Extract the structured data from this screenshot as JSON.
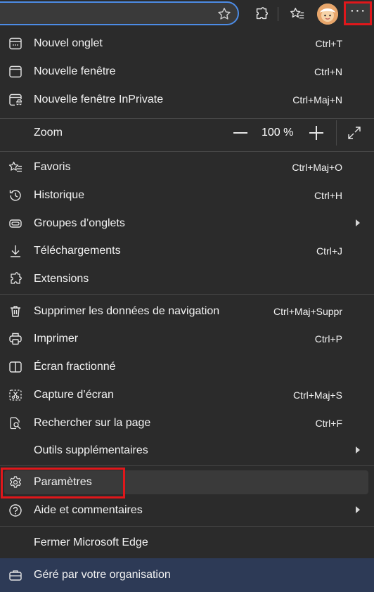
{
  "toolbar": {
    "favorite_star_icon": "star-outline-icon",
    "extensions_icon": "puzzle-icon",
    "favorites_icon": "favorites-icon",
    "profile_icon": "avatar",
    "more_label": "···"
  },
  "menu": {
    "new_tab": {
      "label": "Nouvel onglet",
      "shortcut": "Ctrl+T"
    },
    "new_window": {
      "label": "Nouvelle fenêtre",
      "shortcut": "Ctrl+N"
    },
    "new_inprivate": {
      "label": "Nouvelle fenêtre InPrivate",
      "shortcut": "Ctrl+Maj+N"
    },
    "zoom": {
      "label": "Zoom",
      "value": "100 %"
    },
    "favorites": {
      "label": "Favoris",
      "shortcut": "Ctrl+Maj+O"
    },
    "history": {
      "label": "Historique",
      "shortcut": "Ctrl+H"
    },
    "tab_groups": {
      "label": "Groupes d’onglets"
    },
    "downloads": {
      "label": "Téléchargements",
      "shortcut": "Ctrl+J"
    },
    "extensions": {
      "label": "Extensions"
    },
    "clear_data": {
      "label": "Supprimer les données de navigation",
      "shortcut": "Ctrl+Maj+Suppr"
    },
    "print": {
      "label": "Imprimer",
      "shortcut": "Ctrl+P"
    },
    "split_screen": {
      "label": "Écran fractionné"
    },
    "screenshot": {
      "label": "Capture d’écran",
      "shortcut": "Ctrl+Maj+S"
    },
    "find": {
      "label": "Rechercher sur la page",
      "shortcut": "Ctrl+F"
    },
    "more_tools": {
      "label": "Outils supplémentaires"
    },
    "settings": {
      "label": "Paramètres"
    },
    "help": {
      "label": "Aide et commentaires"
    },
    "close": {
      "label": "Fermer Microsoft Edge"
    },
    "managed": {
      "label": "Géré par votre organisation"
    }
  },
  "colors": {
    "menu_bg": "#2b2b2b",
    "highlight": "#e0171b",
    "managed_bg": "#2d3a56",
    "address_border": "#4c8ce6"
  }
}
